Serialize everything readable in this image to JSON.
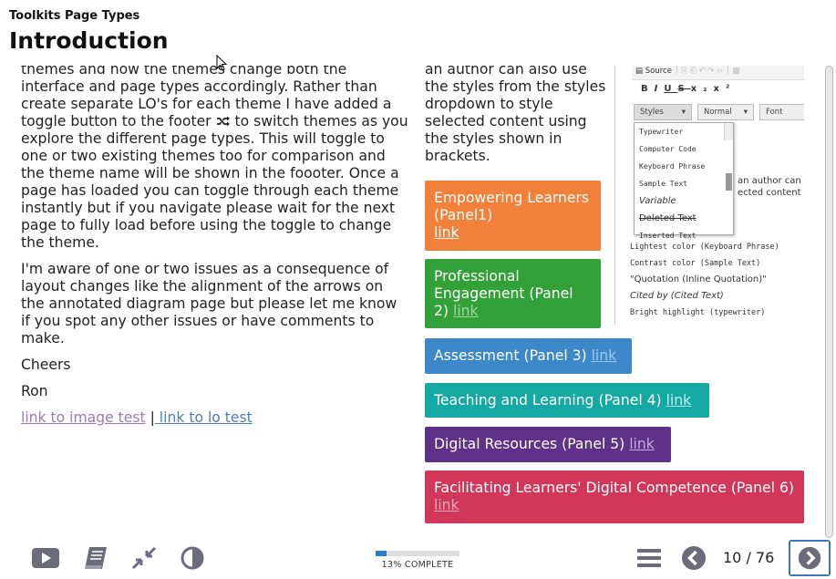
{
  "header": {
    "app_title": "Toolkits Page Types",
    "page_title": "Introduction"
  },
  "left": {
    "para1": "themes and how the themes change both the interface and page types accordingly.  Rather than create separate LO's for each theme I have added a toggle button to the footer",
    "para1_after_icon": "to switch themes as you explore the different page types. This will toggle to one or two existing themes too for comparison and the theme name will be shown in the foooter. Once a page has loaded you can toggle through each theme instantly but if you navigate please wait for the next page to fully load before using the toggle to change the theme.",
    "shuffle_icon": "shuffle-icon",
    "para2": "I'm aware of one or two issues as a consequence of layout changes like the alignment of the arrows on the annotated diagram page but please let me know if you spot any other issues or have comments to make.",
    "sign1": "Cheers",
    "sign2": "Ron",
    "link1": "link to image test",
    "separator": " |",
    "link2": " link to lo test"
  },
  "middle": {
    "text": "an author can also use the styles from the styles dropdown to style selected content using the styles shown in brackets."
  },
  "panels": [
    {
      "label": "Empowering Learners (Panel1)",
      "link": "link",
      "color": "#f0803a"
    },
    {
      "label": "Professional Engagement (Panel 2)",
      "link": "link",
      "color": "#33a139"
    },
    {
      "label": "Assessment (Panel 3)",
      "link": "link",
      "color": "#3d88c9"
    },
    {
      "label": "Teaching and Learning (Panel 4)",
      "link": "link",
      "color": "#16a8a2"
    },
    {
      "label": "Digital Resources (Panel 5)",
      "link": "link",
      "color": "#5f3188"
    },
    {
      "label": "Facilitating Learners' Digital Competence (Panel 6)",
      "link": "link",
      "color": "#d03758"
    }
  ],
  "editor": {
    "source_label": "Source",
    "styles_dd": "Styles",
    "format_dd": "Normal",
    "font_dd": "Font",
    "styles_list": [
      "Typewriter",
      "Computer Code",
      "Keyboard Phrase",
      "Sample Text",
      "Variable",
      "Deleted Text",
      "Inserted Text"
    ],
    "text_line1": "an author can a",
    "text_line2": "ected content us",
    "lines": [
      "Lightest color (Keyboard Phrase)",
      "Contrast color (Sample Text)",
      "\"Quotation (Inline Quotation)\"",
      "Cited by (Cited Text)",
      "Bright highlight (typewriter)"
    ]
  },
  "footer": {
    "progress_percent": 13,
    "progress_label": "13% COMPLETE",
    "page_current": "10",
    "page_sep": " / ",
    "page_total": "76",
    "icons": [
      "video-icon",
      "glossary-book-icon",
      "collapse-icon",
      "theme-contrast-icon",
      "menu-icon",
      "prev-icon",
      "next-icon"
    ]
  }
}
